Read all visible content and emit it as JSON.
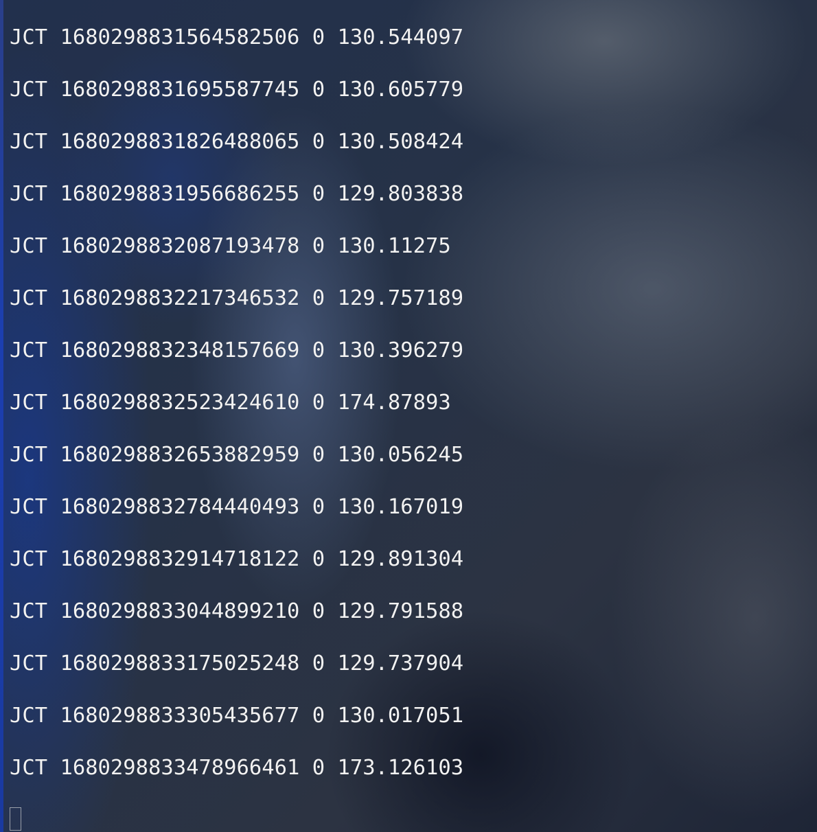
{
  "terminal": {
    "lines": [
      {
        "label": "JCT",
        "id": "1680298831564582506",
        "code": "0",
        "value": "130.544097"
      },
      {
        "label": "JCT",
        "id": "1680298831695587745",
        "code": "0",
        "value": "130.605779"
      },
      {
        "label": "JCT",
        "id": "1680298831826488065",
        "code": "0",
        "value": "130.508424"
      },
      {
        "label": "JCT",
        "id": "1680298831956686255",
        "code": "0",
        "value": "129.803838"
      },
      {
        "label": "JCT",
        "id": "1680298832087193478",
        "code": "0",
        "value": "130.11275"
      },
      {
        "label": "JCT",
        "id": "1680298832217346532",
        "code": "0",
        "value": "129.757189"
      },
      {
        "label": "JCT",
        "id": "1680298832348157669",
        "code": "0",
        "value": "130.396279"
      },
      {
        "label": "JCT",
        "id": "1680298832523424610",
        "code": "0",
        "value": "174.87893"
      },
      {
        "label": "JCT",
        "id": "1680298832653882959",
        "code": "0",
        "value": "130.056245"
      },
      {
        "label": "JCT",
        "id": "1680298832784440493",
        "code": "0",
        "value": "130.167019"
      },
      {
        "label": "JCT",
        "id": "1680298832914718122",
        "code": "0",
        "value": "129.891304"
      },
      {
        "label": "JCT",
        "id": "1680298833044899210",
        "code": "0",
        "value": "129.791588"
      },
      {
        "label": "JCT",
        "id": "1680298833175025248",
        "code": "0",
        "value": "129.737904"
      },
      {
        "label": "JCT",
        "id": "1680298833305435677",
        "code": "0",
        "value": "130.017051"
      },
      {
        "label": "JCT",
        "id": "1680298833478966461",
        "code": "0",
        "value": "173.126103"
      }
    ]
  },
  "colors": {
    "text": "#f2f2f2",
    "background": "#1b2740",
    "accent_edge": "#1c3fb0"
  },
  "icons": {
    "cursor": "block-cursor"
  }
}
